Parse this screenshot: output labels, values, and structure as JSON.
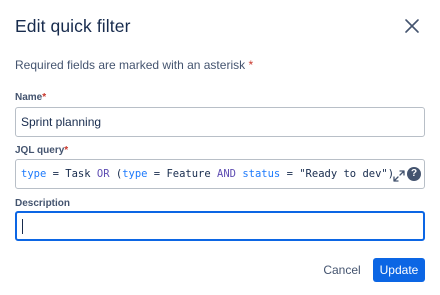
{
  "dialog": {
    "title": "Edit quick filter",
    "close_icon": "close-icon",
    "required_note": "Required fields are marked with an asterisk",
    "asterisk": "*"
  },
  "fields": {
    "name": {
      "label": "Name",
      "value": "Sprint planning"
    },
    "jql": {
      "label": "JQL query",
      "tokens": {
        "t1": "type",
        "t2": " = Task ",
        "t3": "OR",
        "t4": " (",
        "t5": "type",
        "t6": " = Feature ",
        "t7": "AND",
        "t8": " ",
        "t9": "status",
        "t10": " = \"Ready to dev\")"
      },
      "expand_icon": "expand-icon",
      "help_icon": "help-icon",
      "help_glyph": "?"
    },
    "description": {
      "label": "Description",
      "value": ""
    }
  },
  "actions": {
    "cancel_label": "Cancel",
    "update_label": "Update"
  },
  "colors": {
    "primary": "#0c66e4",
    "required": "#c9372c",
    "text": "#172b4d",
    "subtle_text": "#44546f"
  }
}
